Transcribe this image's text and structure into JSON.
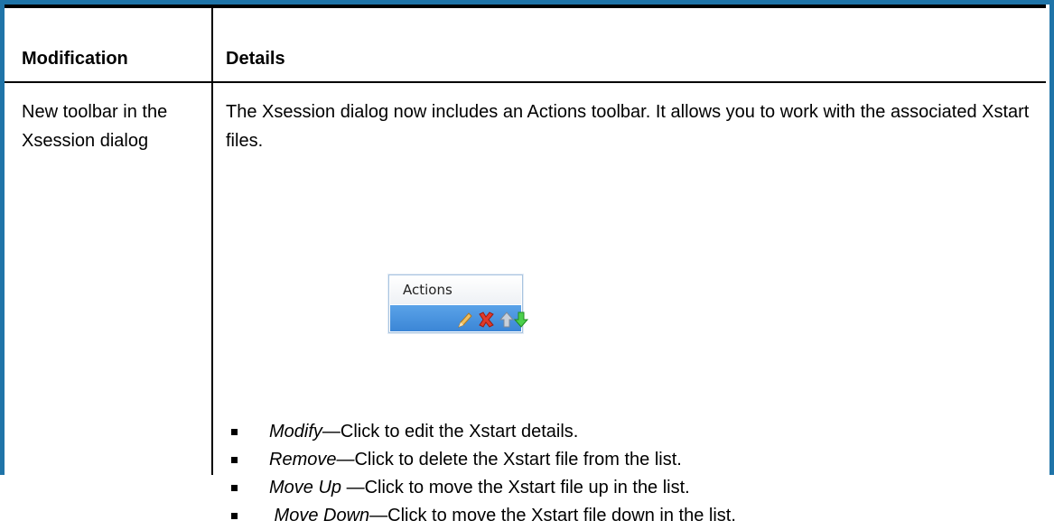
{
  "table": {
    "headers": [
      "Modification",
      "Details"
    ],
    "rows": [
      {
        "modification": "New toolbar in the Xsession dialog",
        "details": "The Xsession dialog now includes an Actions toolbar. It allows you to work with the associated Xstart files.",
        "toolbar_image": {
          "title": "Actions",
          "icons": [
            "pencil-icon",
            "red-x-icon",
            "up-arrow-icon",
            "down-arrow-icon"
          ],
          "colors": {
            "bar": "#3b86d6",
            "remove": "#e03a2a",
            "up": "#a8b4c4",
            "down": "#3cbf3c",
            "pencil": "#e8b24a"
          }
        },
        "bullets": [
          {
            "term": "Modify",
            "text": "—Click to edit the Xstart details."
          },
          {
            "term": "Remove",
            "text": "—Click to delete the Xstart file from the list."
          },
          {
            "term": "Move Up ",
            "text": "—Click to move the Xstart file up in the list."
          },
          {
            "term": " Move Down",
            "text": "—Click to move the Xstart file down in the list."
          }
        ]
      }
    ]
  },
  "colors": {
    "frame": "#1f74a8"
  }
}
